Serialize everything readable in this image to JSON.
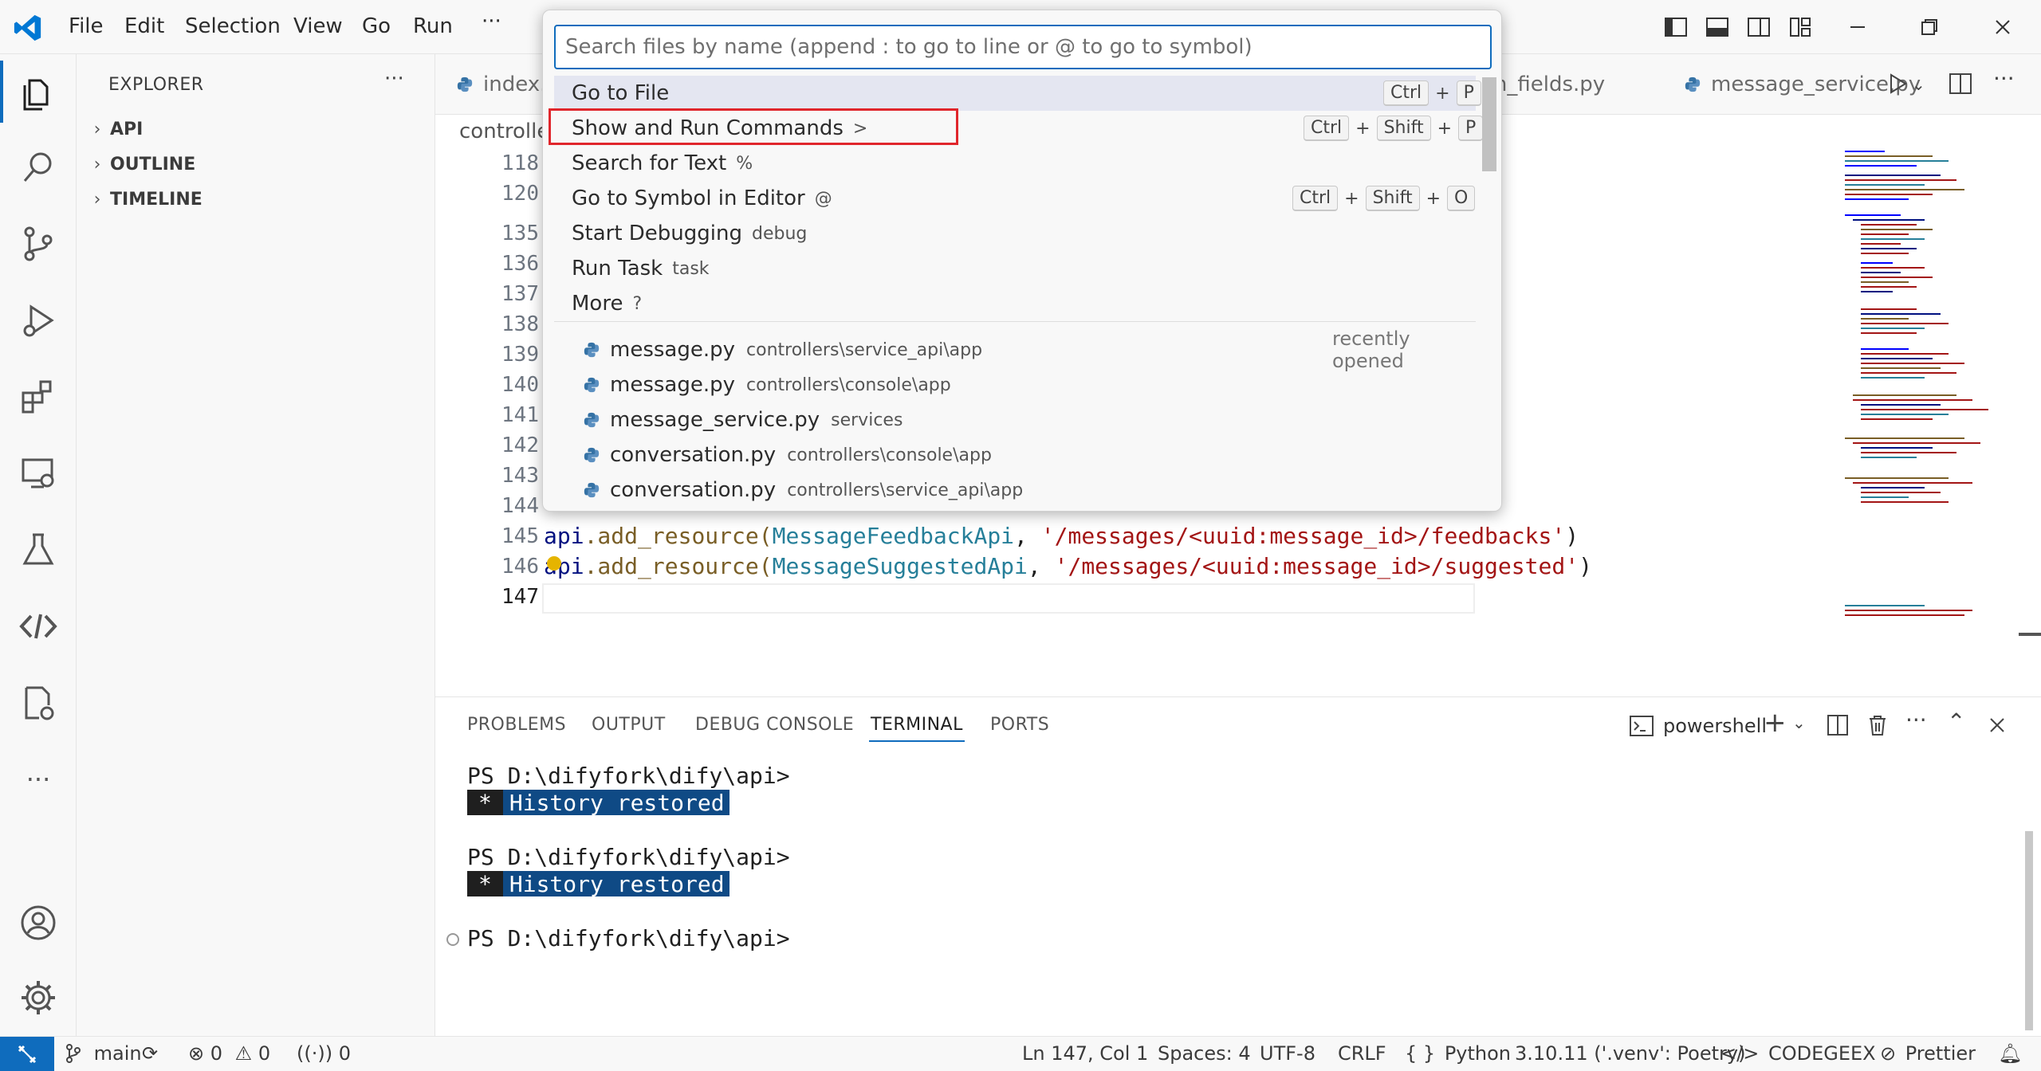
{
  "menu": [
    "File",
    "Edit",
    "Selection",
    "View",
    "Go",
    "Run",
    "···"
  ],
  "sidebar": {
    "title": "EXPLORER",
    "more": "···",
    "sections": [
      {
        "label": "API"
      },
      {
        "label": "OUTLINE"
      },
      {
        "label": "TIMELINE"
      }
    ]
  },
  "tabs": [
    {
      "label": "index."
    },
    {
      "label": "on_fields.py"
    },
    {
      "label": "message_service.py"
    }
  ],
  "breadcrumb": "controlle",
  "editor": {
    "lines": [
      {
        "n": "118",
        "text": ""
      },
      {
        "n": "120",
        "text": ""
      },
      {
        "n": "135",
        "text": ""
      },
      {
        "n": "136",
        "text": ""
      },
      {
        "n": "137",
        "text": ""
      },
      {
        "n": "138",
        "text": ""
      },
      {
        "n": "139",
        "text": ""
      },
      {
        "n": "140",
        "text": ""
      },
      {
        "n": "141",
        "text": ""
      },
      {
        "n": "142",
        "text": ""
      },
      {
        "n": "143",
        "text": ""
      },
      {
        "n": "144",
        "text": ""
      },
      {
        "n": "145",
        "text": ""
      },
      {
        "n": "146",
        "text": ""
      },
      {
        "n": "147",
        "text": ""
      }
    ],
    "line145": {
      "obj": "api",
      "method": ".add_resource(",
      "cls": "MessageFeedbackApi",
      "sep": ", ",
      "str": "'/messages/<uuid:message_id>/feedbacks'",
      "end": ")"
    },
    "line146": {
      "obj": "api",
      "method": ".add_resource(",
      "cls": "MessageSuggestedApi",
      "sep": ", ",
      "str": "'/messages/<uuid:message_id>/suggested'",
      "end": ")"
    }
  },
  "quick_open": {
    "placeholder": "Search files by name (append : to go to line or @ to go to symbol)",
    "commands": [
      {
        "label": "Go to File",
        "prefix": "",
        "keys": [
          "Ctrl",
          "P"
        ]
      },
      {
        "label": "Show and Run Commands",
        "prefix": ">",
        "keys": [
          "Ctrl",
          "Shift",
          "P"
        ]
      },
      {
        "label": "Search for Text",
        "prefix": "%",
        "keys": []
      },
      {
        "label": "Go to Symbol in Editor",
        "prefix": "@",
        "keys": [
          "Ctrl",
          "Shift",
          "O"
        ]
      },
      {
        "label": "Start Debugging",
        "prefix": "debug",
        "keys": []
      },
      {
        "label": "Run Task",
        "prefix": "task",
        "keys": []
      },
      {
        "label": "More",
        "prefix": "?",
        "keys": []
      }
    ],
    "recently_opened_label": "recently opened",
    "files": [
      {
        "name": "message.py",
        "path": "controllers\\service_api\\app"
      },
      {
        "name": "message.py",
        "path": "controllers\\console\\app"
      },
      {
        "name": "message_service.py",
        "path": "services"
      },
      {
        "name": "conversation.py",
        "path": "controllers\\console\\app"
      },
      {
        "name": "conversation.py",
        "path": "controllers\\service_api\\app"
      }
    ]
  },
  "panel": {
    "tabs": [
      "PROBLEMS",
      "OUTPUT",
      "DEBUG CONSOLE",
      "TERMINAL",
      "PORTS"
    ],
    "active_tab": "TERMINAL",
    "shell": "powershell",
    "terminal": {
      "prompt": "PS D:\\difyfork\\dify\\api>",
      "history_star": "*",
      "history_text": "History restored"
    }
  },
  "statusbar": {
    "branch": "main",
    "errors": "0",
    "warnings": "0",
    "ports": "0",
    "position": "Ln 147, Col 1",
    "spaces": "Spaces: 4",
    "encoding": "UTF-8",
    "eol": "CRLF",
    "language": "Python",
    "interpreter": "3.10.11 ('.venv': Poetry)",
    "codegeex": "CODEGEEX",
    "prettier": "Prettier"
  },
  "colors": {
    "accent": "#0f6cbd",
    "highlight_box": "#e0262c",
    "history_bg": "#0f4a85",
    "string": "#a31515",
    "class": "#267f99"
  }
}
